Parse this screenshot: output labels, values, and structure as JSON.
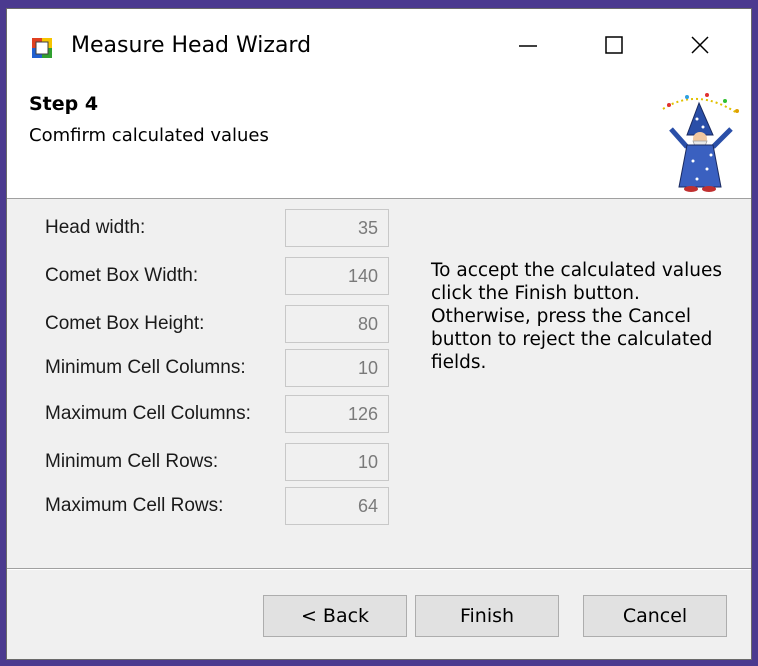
{
  "window": {
    "title": "Measure Head Wizard"
  },
  "header": {
    "step": "Step 4",
    "description": "Comfirm calculated values"
  },
  "fields": [
    {
      "label": "Head width:",
      "value": "35"
    },
    {
      "label": "Comet Box Width:",
      "value": "140"
    },
    {
      "label": "Comet Box Height:",
      "value": "80"
    },
    {
      "label": "Minimum Cell Columns:",
      "value": "10"
    },
    {
      "label": "Maximum Cell Columns:",
      "value": "126"
    },
    {
      "label": "Minimum Cell Rows:",
      "value": "10"
    },
    {
      "label": "Maximum Cell Rows:",
      "value": "64"
    }
  ],
  "info": "To accept the calculated values click the Finish button. Otherwise, press the Cancel button to reject the calculated fields.",
  "buttons": {
    "back": "< Back",
    "finish": "Finish",
    "cancel": "Cancel"
  },
  "icons": {
    "app": "wizard-app-icon",
    "mascot": "wizard-mascot"
  }
}
